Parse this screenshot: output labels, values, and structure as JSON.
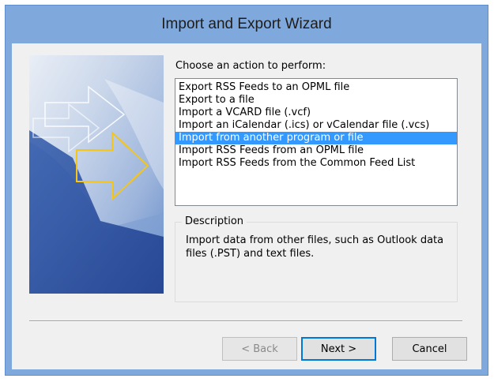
{
  "window": {
    "title": "Import and Export Wizard"
  },
  "main": {
    "prompt": "Choose an action to perform:",
    "actions": [
      {
        "label": "Export RSS Feeds to an OPML file",
        "selected": false
      },
      {
        "label": "Export to a file",
        "selected": false
      },
      {
        "label": "Import a VCARD file (.vcf)",
        "selected": false
      },
      {
        "label": "Import an iCalendar (.ics) or vCalendar file (.vcs)",
        "selected": false
      },
      {
        "label": "Import from another program or file",
        "selected": true
      },
      {
        "label": "Import RSS Feeds from an OPML file",
        "selected": false
      },
      {
        "label": "Import RSS Feeds from the Common Feed List",
        "selected": false
      }
    ],
    "description": {
      "legend": "Description",
      "text": "Import data from other files, such as Outlook data files (.PST) and text files."
    }
  },
  "buttons": {
    "back": "< Back",
    "next": "Next >",
    "cancel": "Cancel"
  },
  "colors": {
    "titlebar": "#7fa8dc",
    "selection": "#3399ff",
    "dialog_bg": "#f0f0f0",
    "arrow_accent": "#f5c518"
  }
}
